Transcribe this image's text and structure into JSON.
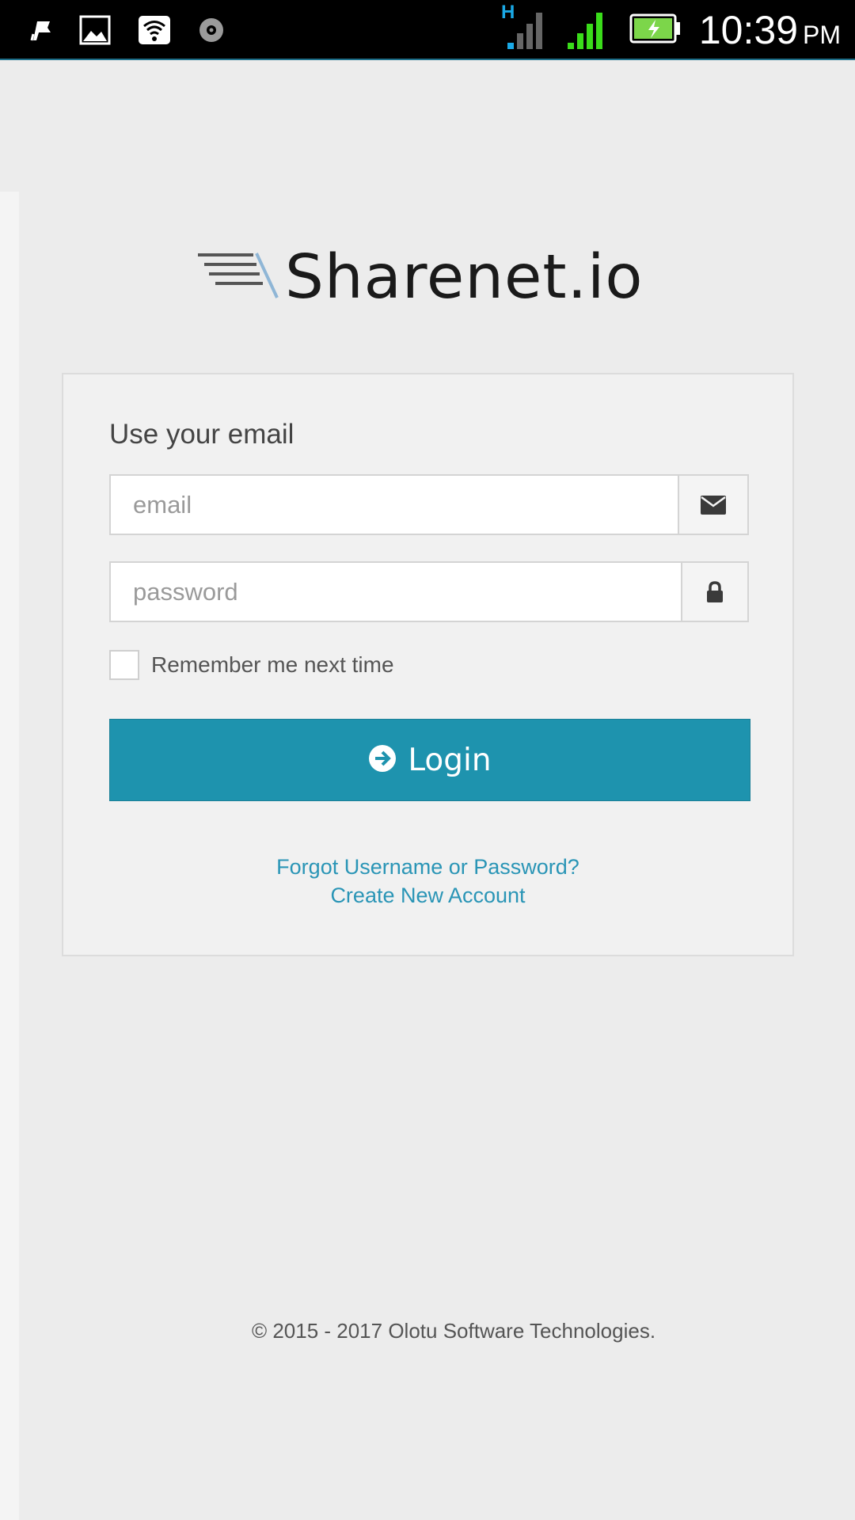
{
  "status_bar": {
    "network_type": "H",
    "time": "10:39",
    "ampm": "PM",
    "icons": [
      "notification-flag-icon",
      "image-icon",
      "wifi-icon",
      "sync-disc-icon",
      "signal-sim1-icon",
      "signal-sim2-icon",
      "battery-charging-icon"
    ],
    "colors": {
      "background": "#000000",
      "signal_blue": "#1aa9e6",
      "signal_green": "#3adc1a",
      "battery": "#7cd64a"
    }
  },
  "logo": {
    "text": "Sharenet.io"
  },
  "login_card": {
    "heading": "Use your email",
    "email_placeholder": "email",
    "password_placeholder": "password",
    "remember_label": "Remember me next time",
    "remember_checked": false,
    "login_label": "Login",
    "forgot_link": "Forgot Username or Password?",
    "create_link": "Create New Account"
  },
  "footer": {
    "copyright": "© 2015 - 2017 Olotu Software Technologies."
  },
  "colors": {
    "accent": "#1e93ae",
    "link": "#2a95b6",
    "page_bg": "#ececec"
  }
}
